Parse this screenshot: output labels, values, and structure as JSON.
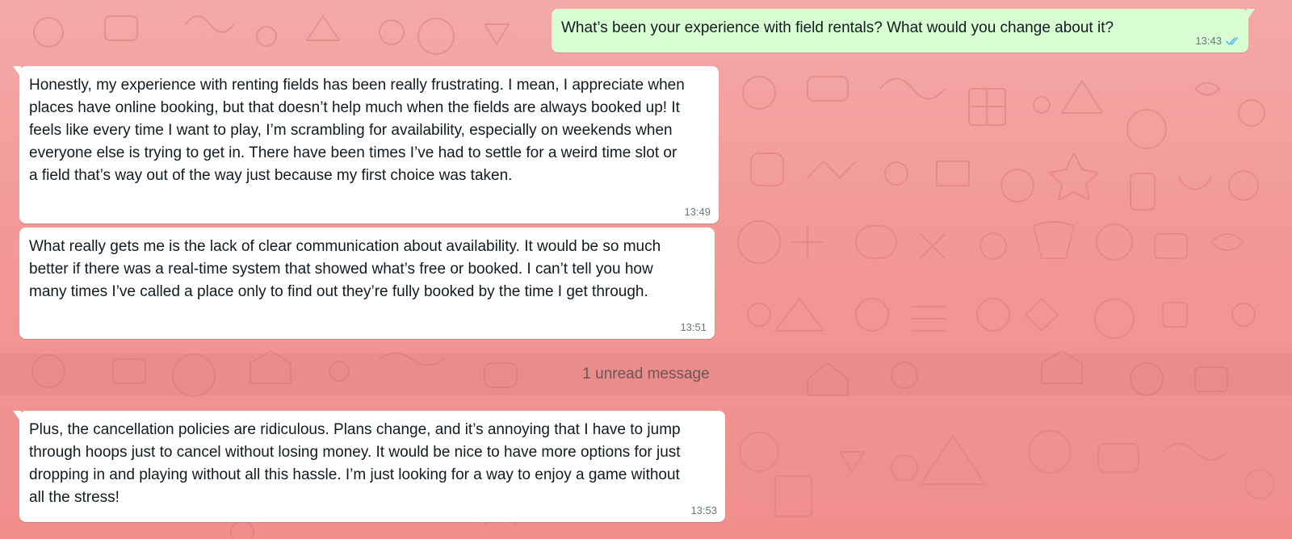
{
  "messages": [
    {
      "direction": "outgoing",
      "text": "What’s been your experience with field rentals? What would you change about it?",
      "time": "13:43",
      "status_icon": "double-check-read-icon"
    },
    {
      "direction": "incoming",
      "text": "Honestly, my experience with renting fields has been really frustrating. I mean, I appreciate when places have online booking, but that doesn’t help much when the fields are always booked up! It feels like every time I want to play, I’m scrambling for availability, especially on weekends when everyone else is trying to get in. There have been times I’ve had to settle for a weird time slot or a field that’s way out of the way just because my first choice was taken.",
      "time": "13:49"
    },
    {
      "direction": "incoming",
      "text": "What really gets me is the lack of clear communication about availability. It would be so much better if there was a real-time system that showed what’s free or booked. I can’t tell you how many times I’ve called a place only to find out they’re fully booked by the time I get through.",
      "time": "13:51"
    },
    {
      "direction": "incoming",
      "text": "Plus, the cancellation policies are ridiculous. Plans change, and it’s annoying that I have to jump through hoops just to cancel without losing money. It would be nice to have more options for just dropping in and playing without all this hassle. I’m just looking for a way to enjoy a game without all the stress!",
      "time": "13:53"
    }
  ],
  "unread_divider": "1 unread message",
  "colors": {
    "wallpaper": "#f29896",
    "incoming_bubble": "#ffffff",
    "outgoing_bubble": "#d9fdd3",
    "read_ticks": "#53bdeb",
    "meta_text": "#667781"
  }
}
